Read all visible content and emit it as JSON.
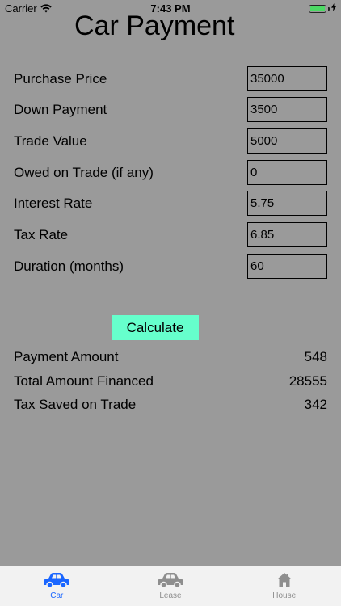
{
  "status_bar": {
    "carrier": "Carrier",
    "time": "7:43 PM"
  },
  "title": "Car Payment",
  "form": {
    "fields": [
      {
        "label": "Purchase Price",
        "value": "35000"
      },
      {
        "label": "Down Payment",
        "value": "3500"
      },
      {
        "label": "Trade Value",
        "value": "5000"
      },
      {
        "label": "Owed on Trade (if any)",
        "value": "0"
      },
      {
        "label": "Interest Rate",
        "value": "5.75"
      },
      {
        "label": "Tax Rate",
        "value": "6.85"
      },
      {
        "label": "Duration (months)",
        "value": "60"
      }
    ]
  },
  "calculate_label": "Calculate",
  "results": [
    {
      "label": "Payment Amount",
      "value": "548"
    },
    {
      "label": "Total Amount Financed",
      "value": "28555"
    },
    {
      "label": "Tax Saved on Trade",
      "value": "342"
    }
  ],
  "tab_bar": {
    "tabs": [
      {
        "label": "Car",
        "icon": "car-icon",
        "active": true
      },
      {
        "label": "Lease",
        "icon": "car-icon",
        "active": false
      },
      {
        "label": "House",
        "icon": "house-icon",
        "active": false
      }
    ]
  },
  "colors": {
    "background": "#9a9a9a",
    "calculate_button": "#66ffcc",
    "tab_active": "#1a66ff",
    "tab_inactive": "#8e8e8e",
    "battery": "#4cd964"
  }
}
